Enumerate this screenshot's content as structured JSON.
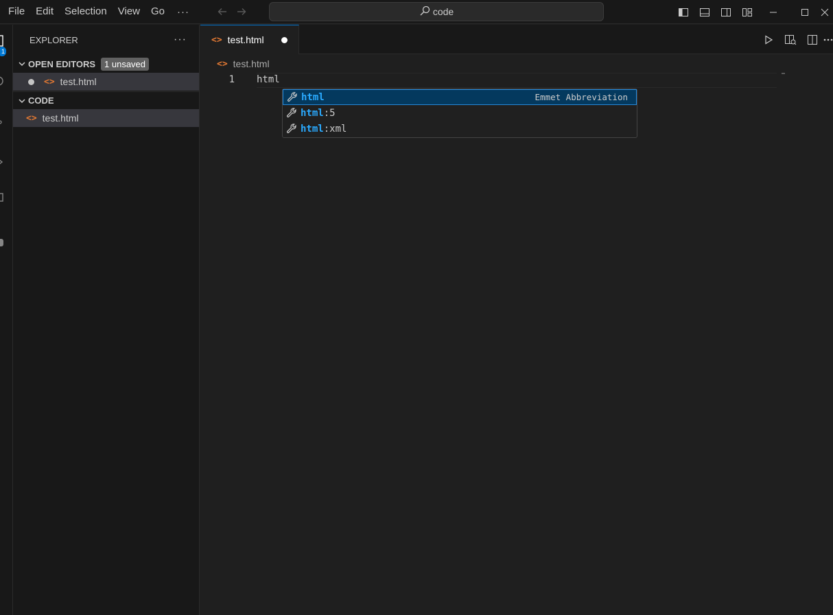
{
  "menu": {
    "items": [
      "File",
      "Edit",
      "Selection",
      "View",
      "Go"
    ],
    "more": "···"
  },
  "search": {
    "text": "code"
  },
  "activity": {
    "badge": "1"
  },
  "sidebar": {
    "title": "EXPLORER",
    "more": "···",
    "open_editors": {
      "header": "OPEN EDITORS",
      "badge": "1 unsaved",
      "items": [
        {
          "label": "test.html",
          "dirty": true
        }
      ]
    },
    "folder": {
      "header": "CODE",
      "items": [
        {
          "label": "test.html"
        }
      ]
    }
  },
  "tab": {
    "label": "test.html",
    "dirty": true
  },
  "breadcrumb": {
    "file": "test.html"
  },
  "editor": {
    "line_number": "1",
    "code": "html"
  },
  "suggest": {
    "items": [
      {
        "match": "html",
        "rest": "",
        "detail": "Emmet Abbreviation",
        "focused": true
      },
      {
        "match": "html",
        "rest": ":5",
        "detail": "",
        "focused": false
      },
      {
        "match": "html",
        "rest": ":xml",
        "detail": "",
        "focused": false
      }
    ]
  },
  "colors": {
    "accent": "#0078d4",
    "html_icon": "#e37933",
    "match_highlight": "#2aaaff",
    "focus_row": "#04395e"
  }
}
